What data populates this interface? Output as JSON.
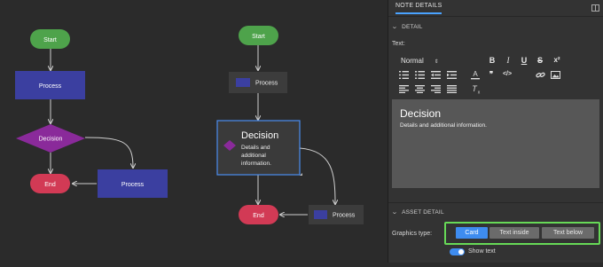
{
  "canvas": {
    "left_flow": {
      "start": "Start",
      "process": "Process",
      "decision": "Decision",
      "end": "End",
      "process2": "Process"
    },
    "right_flow": {
      "start": "Start",
      "process": "Process",
      "decision_title": "Decision",
      "decision_body_1": "Details and",
      "decision_body_2": "additional",
      "decision_body_3": "information.",
      "end": "End",
      "process2": "Process"
    }
  },
  "panel": {
    "tab": "NOTE DETAILS",
    "detail_section": "DETAIL",
    "text_label": "Text:",
    "format_select": "Normal",
    "toolbar": {
      "bold": "B",
      "italic": "I",
      "underline": "U",
      "strike": "S",
      "superscript": "x²",
      "quote": "❞",
      "code": "</>"
    },
    "editor": {
      "title": "Decision",
      "body": "Details and additional information."
    },
    "asset_section": "ASSET DETAIL",
    "graphics_type_label": "Graphics type:",
    "graphics_options": [
      "Card",
      "Text inside",
      "Text below"
    ],
    "graphics_selected": "Card",
    "show_text_label": "Show text",
    "colors": {
      "accent": "#3e8cf0",
      "start_node": "#4ea34b",
      "process_node": "#3b3fa0",
      "decision_node": "#8a2a9a",
      "end_node": "#d23a55",
      "highlight": "#67d957"
    }
  }
}
